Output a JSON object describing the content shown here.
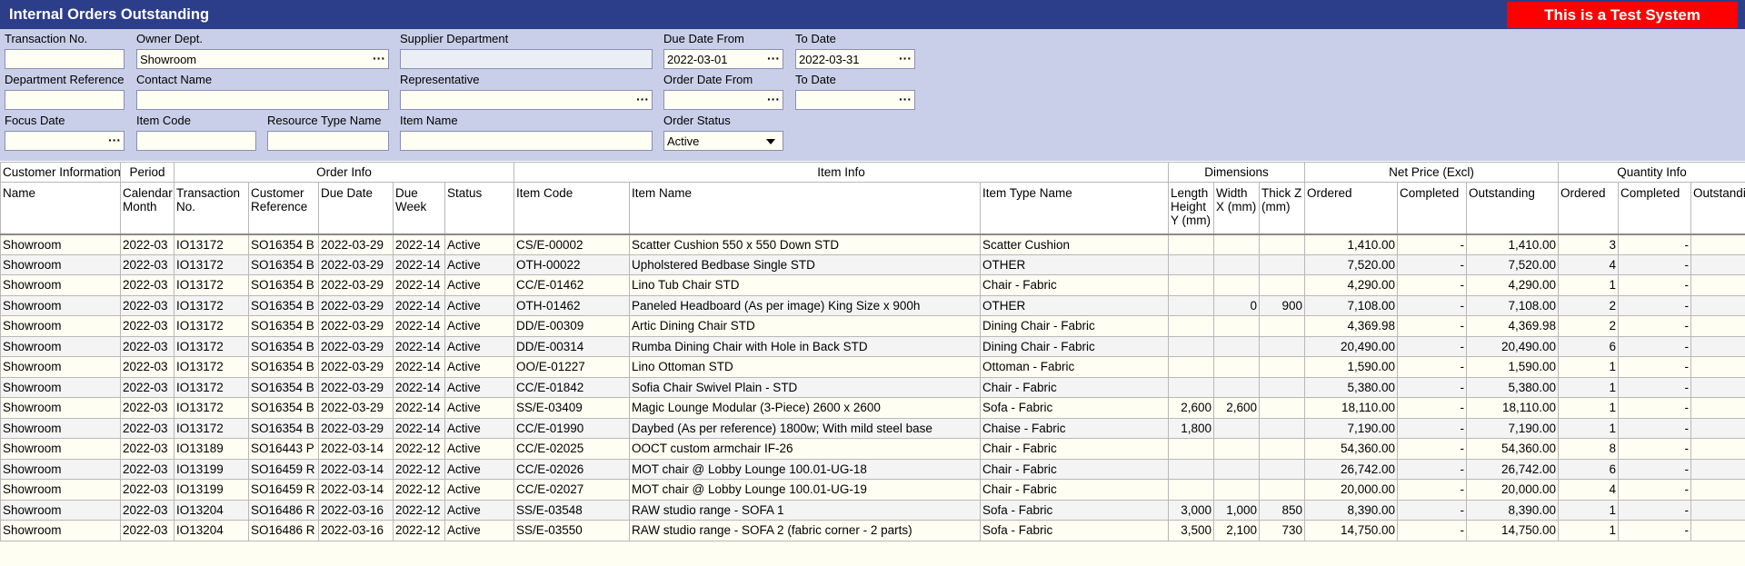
{
  "window": {
    "title": "Internal Orders Outstanding",
    "test_banner": "This is a Test System"
  },
  "filters": {
    "transaction_no": {
      "label": "Transaction No.",
      "value": ""
    },
    "owner_dept": {
      "label": "Owner Dept.",
      "value": "Showroom"
    },
    "supplier_department": {
      "label": "Supplier Department",
      "value": ""
    },
    "due_date_from": {
      "label": "Due Date From",
      "value": "2022-03-01"
    },
    "due_date_to": {
      "label": "To Date",
      "value": "2022-03-31"
    },
    "department_reference": {
      "label": "Department Reference",
      "value": ""
    },
    "contact_name": {
      "label": "Contact Name",
      "value": ""
    },
    "representative": {
      "label": "Representative",
      "value": ""
    },
    "order_date_from": {
      "label": "Order Date From",
      "value": ""
    },
    "order_date_to": {
      "label": "To Date",
      "value": ""
    },
    "focus_date": {
      "label": "Focus Date",
      "value": ""
    },
    "item_code": {
      "label": "Item Code",
      "value": ""
    },
    "resource_type_name": {
      "label": "Resource Type Name",
      "value": ""
    },
    "item_name": {
      "label": "Item Name",
      "value": ""
    },
    "order_status": {
      "label": "Order Status",
      "value": "Active"
    }
  },
  "grid": {
    "groups": [
      "Customer Information",
      "Period",
      "Order Info",
      "Item Info",
      "Dimensions",
      "Net Price (Excl)",
      "Quantity Info"
    ],
    "columns": [
      "Name",
      "Calendar Month",
      "Transaction No.",
      "Customer Reference",
      "Due Date",
      "Due Week",
      "Status",
      "Item Code",
      "Item Name",
      "Item Type Name",
      "Length Height Y (mm)",
      "Width X (mm)",
      "Thick Z (mm)",
      "Ordered",
      "Completed",
      "Outstanding",
      "Ordered",
      "Completed",
      "Outstanding"
    ],
    "rows": [
      [
        "Showroom",
        "2022-03",
        "IO13172",
        "SO16354 B",
        "2022-03-29",
        "2022-14",
        "Active",
        "CS/E-00002",
        "Scatter Cushion 550 x 550 Down STD",
        "Scatter Cushion",
        "",
        "",
        "",
        "1,410.00",
        "-",
        "1,410.00",
        "3",
        "-",
        ""
      ],
      [
        "Showroom",
        "2022-03",
        "IO13172",
        "SO16354 B",
        "2022-03-29",
        "2022-14",
        "Active",
        "OTH-00022",
        "Upholstered Bedbase Single STD",
        "OTHER",
        "",
        "",
        "",
        "7,520.00",
        "-",
        "7,520.00",
        "4",
        "-",
        ""
      ],
      [
        "Showroom",
        "2022-03",
        "IO13172",
        "SO16354 B",
        "2022-03-29",
        "2022-14",
        "Active",
        "CC/E-01462",
        "Lino Tub Chair STD",
        "Chair - Fabric",
        "",
        "",
        "",
        "4,290.00",
        "-",
        "4,290.00",
        "1",
        "-",
        ""
      ],
      [
        "Showroom",
        "2022-03",
        "IO13172",
        "SO16354 B",
        "2022-03-29",
        "2022-14",
        "Active",
        "OTH-01462",
        "Paneled Headboard (As per image) King Size x 900h",
        "OTHER",
        "",
        "0",
        "900",
        "7,108.00",
        "-",
        "7,108.00",
        "2",
        "-",
        ""
      ],
      [
        "Showroom",
        "2022-03",
        "IO13172",
        "SO16354 B",
        "2022-03-29",
        "2022-14",
        "Active",
        "DD/E-00309",
        "Artic Dining Chair STD",
        "Dining Chair - Fabric",
        "",
        "",
        "",
        "4,369.98",
        "-",
        "4,369.98",
        "2",
        "-",
        ""
      ],
      [
        "Showroom",
        "2022-03",
        "IO13172",
        "SO16354 B",
        "2022-03-29",
        "2022-14",
        "Active",
        "DD/E-00314",
        "Rumba Dining Chair with Hole in Back STD",
        "Dining Chair - Fabric",
        "",
        "",
        "",
        "20,490.00",
        "-",
        "20,490.00",
        "6",
        "-",
        ""
      ],
      [
        "Showroom",
        "2022-03",
        "IO13172",
        "SO16354 B",
        "2022-03-29",
        "2022-14",
        "Active",
        "OO/E-01227",
        "Lino Ottoman STD",
        "Ottoman - Fabric",
        "",
        "",
        "",
        "1,590.00",
        "-",
        "1,590.00",
        "1",
        "-",
        ""
      ],
      [
        "Showroom",
        "2022-03",
        "IO13172",
        "SO16354 B",
        "2022-03-29",
        "2022-14",
        "Active",
        "CC/E-01842",
        "Sofia Chair Swivel Plain - STD",
        "Chair - Fabric",
        "",
        "",
        "",
        "5,380.00",
        "-",
        "5,380.00",
        "1",
        "-",
        ""
      ],
      [
        "Showroom",
        "2022-03",
        "IO13172",
        "SO16354 B",
        "2022-03-29",
        "2022-14",
        "Active",
        "SS/E-03409",
        "Magic Lounge Modular (3-Piece) 2600 x 2600",
        "Sofa - Fabric",
        "2,600",
        "2,600",
        "",
        "18,110.00",
        "-",
        "18,110.00",
        "1",
        "-",
        ""
      ],
      [
        "Showroom",
        "2022-03",
        "IO13172",
        "SO16354 B",
        "2022-03-29",
        "2022-14",
        "Active",
        "CC/E-01990",
        "Daybed (As per reference) 1800w; With mild steel base",
        "Chaise - Fabric",
        "1,800",
        "",
        "",
        "7,190.00",
        "-",
        "7,190.00",
        "1",
        "-",
        ""
      ],
      [
        "Showroom",
        "2022-03",
        "IO13189",
        "SO16443 P",
        "2022-03-14",
        "2022-12",
        "Active",
        "CC/E-02025",
        "OOCT custom armchair IF-26",
        "Chair - Fabric",
        "",
        "",
        "",
        "54,360.00",
        "-",
        "54,360.00",
        "8",
        "-",
        ""
      ],
      [
        "Showroom",
        "2022-03",
        "IO13199",
        "SO16459 R",
        "2022-03-14",
        "2022-12",
        "Active",
        "CC/E-02026",
        "MOT chair @ Lobby Lounge 100.01-UG-18",
        "Chair - Fabric",
        "",
        "",
        "",
        "26,742.00",
        "-",
        "26,742.00",
        "6",
        "-",
        ""
      ],
      [
        "Showroom",
        "2022-03",
        "IO13199",
        "SO16459 R",
        "2022-03-14",
        "2022-12",
        "Active",
        "CC/E-02027",
        "MOT chair @ Lobby Lounge 100.01-UG-19",
        "Chair - Fabric",
        "",
        "",
        "",
        "20,000.00",
        "-",
        "20,000.00",
        "4",
        "-",
        ""
      ],
      [
        "Showroom",
        "2022-03",
        "IO13204",
        "SO16486 R",
        "2022-03-16",
        "2022-12",
        "Active",
        "SS/E-03548",
        "RAW studio range - SOFA 1",
        "Sofa - Fabric",
        "3,000",
        "1,000",
        "850",
        "8,390.00",
        "-",
        "8,390.00",
        "1",
        "-",
        ""
      ],
      [
        "Showroom",
        "2022-03",
        "IO13204",
        "SO16486 R",
        "2022-03-16",
        "2022-12",
        "Active",
        "SS/E-03550",
        "RAW studio range - SOFA 2 (fabric corner - 2 parts)",
        "Sofa - Fabric",
        "3,500",
        "2,100",
        "730",
        "14,750.00",
        "-",
        "14,750.00",
        "1",
        "-",
        ""
      ]
    ]
  }
}
